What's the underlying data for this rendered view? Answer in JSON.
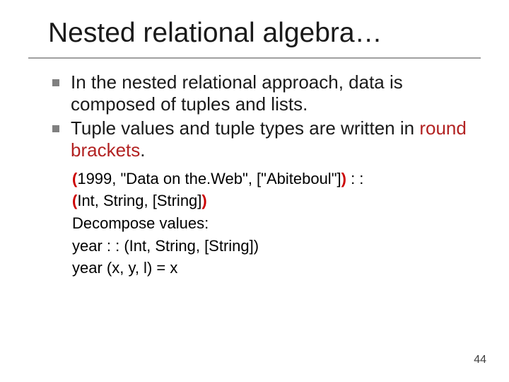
{
  "title": "Nested relational algebra…",
  "bullets": [
    {
      "text": "In the nested relational approach, data is composed of tuples and lists."
    },
    {
      "pre": "Tuple values and tuple types are written in ",
      "em": "round brackets",
      "post": "."
    }
  ],
  "code": {
    "l1_open": "(",
    "l1_body": "1999, \"Data on the.Web\", [\"Abiteboul\"]",
    "l1_close": ")",
    "l1_tail": " : :",
    "l2_open": "(",
    "l2_body": "Int, String, [String]",
    "l2_close": ")",
    "l3": "Decompose values:",
    "l4": "year : : (Int, String, [String])",
    "l5": "year (x, y, l) = x"
  },
  "pagenum": "44"
}
